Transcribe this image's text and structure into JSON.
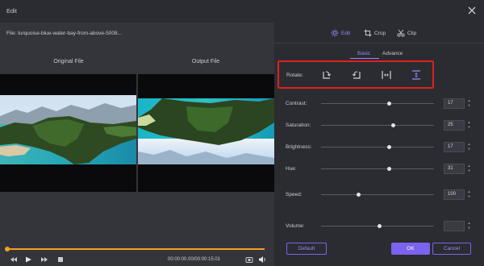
{
  "window": {
    "title": "Edit"
  },
  "file": {
    "label": "File: turquoise-blue-water-bay-from-above-5008..."
  },
  "preview": {
    "original_label": "Original File",
    "output_label": "Output File"
  },
  "playback": {
    "timecode": "00:00:00.00/00:00:15.01",
    "progress": 0
  },
  "tabs": [
    {
      "label": "Edit",
      "icon": "edit-icon",
      "active": true
    },
    {
      "label": "Crop",
      "icon": "crop-icon",
      "active": false
    },
    {
      "label": "Clip",
      "icon": "clip-icon",
      "active": false
    }
  ],
  "subtabs": [
    {
      "label": "Basic",
      "active": true
    },
    {
      "label": "Advance",
      "active": false
    }
  ],
  "rotate": {
    "label": "Rotate:",
    "buttons": [
      "rotate-right-icon",
      "rotate-left-icon",
      "flip-horizontal-icon",
      "flip-vertical-icon"
    ],
    "active_index": 3
  },
  "adjustments": [
    {
      "label": "Contrast:",
      "value": "17",
      "min": -100,
      "max": 100
    },
    {
      "label": "Saturation:",
      "value": "25",
      "min": -100,
      "max": 100
    },
    {
      "label": "Brightness:",
      "value": "17",
      "min": -100,
      "max": 100
    },
    {
      "label": "Hue:",
      "value": "31",
      "min": -180,
      "max": 180
    },
    {
      "label": "Speed:",
      "value": "100",
      "min": 0,
      "max": 300
    },
    {
      "label": "Volume:",
      "value": "",
      "min": 0,
      "max": 200,
      "disabled": true
    }
  ],
  "buttons": {
    "default": "Default",
    "ok": "OK",
    "cancel": "Cancel"
  },
  "colors": {
    "accent": "#7b62ef",
    "highlight_box": "#e02020",
    "timeline": "#f0a21e"
  }
}
